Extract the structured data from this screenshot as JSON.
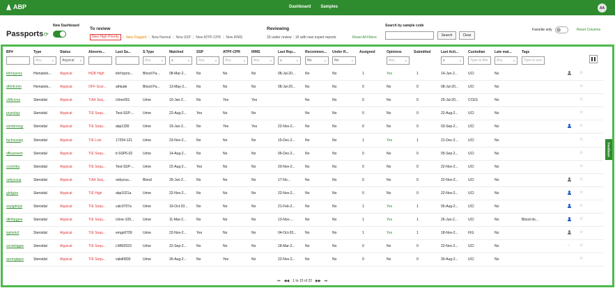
{
  "app": {
    "name": "ABP",
    "nav": [
      "Dashboard",
      "Samples"
    ],
    "user_initials": "AA"
  },
  "page": {
    "title": "Passports",
    "new_dashboard_label": "New Dashboard"
  },
  "to_review": {
    "title": "To review",
    "filters": [
      "New High Priority",
      "New Flagged",
      "New Normal",
      "New SSP",
      "New ATPF-CPR",
      "New IRMS"
    ]
  },
  "reviewing": {
    "title": "Reviewing",
    "under_review": "33 under review",
    "expert_reports": "16 with new expert reports",
    "reset_all": "Reset All Filters"
  },
  "search": {
    "label": "Search by sample code",
    "search_button": "Search",
    "clear_button": "Clear"
  },
  "favorite": {
    "label": "Favorite only",
    "reset_columns": "Reset Columns"
  },
  "feedback": "Feedback",
  "columns": [
    "BP#",
    "Type",
    "Status",
    "Abnorm...",
    "Last Sa...",
    "S.Type",
    "Matched",
    "SSP",
    "ATPF-CPR",
    "IRMS",
    "Last Rep...",
    "Recommen...",
    "Under R...",
    "Assigned",
    "Opinions",
    "Submitted",
    "Last Acti...",
    "Custodian",
    "Late mat...",
    "Tags"
  ],
  "column_filters": {
    "type": "Any",
    "status": "Atypical",
    "stype": "Any",
    "matched": "≥",
    "ssp": "Any",
    "atpf": "Any",
    "irms": "Any",
    "lastrep": "≥",
    "recommen": "No",
    "under": "No",
    "opinions": "Any",
    "lastact": "≥",
    "custodian": "Type to filte",
    "late": "Any",
    "tags": "Type to sea"
  },
  "rows": [
    {
      "bp": "khrhcpnov",
      "type": "Hematolo...",
      "status": "Atypical",
      "abnorm": "HGB High",
      "last_sample": "khrhcpno...",
      "stype": "Blood Pa...",
      "matched": "08-Mar-2...",
      "ssp": "No",
      "atpf": "No",
      "irms": "No",
      "last_rep": "08-Jul-20...",
      "recommen": "No",
      "under": "No",
      "assigned": "1",
      "opinions": "Yes",
      "submitted": "1",
      "last_act": "14-Jun-2...",
      "custodian": "UCI",
      "late": "No",
      "tags": "",
      "person": "grey"
    },
    {
      "bp": "dhfnfcmm",
      "type": "Hematolo...",
      "status": "Atypical",
      "abnorm": "OFF-Scor...",
      "last_sample": "aihtude",
      "stype": "Blood Pa...",
      "matched": "13-May-2...",
      "ssp": "No",
      "atpf": "No",
      "irms": "No",
      "last_rep": "08-Jul-20...",
      "recommen": "No",
      "under": "No",
      "assigned": "0",
      "opinions": "No",
      "submitted": "0",
      "last_act": "08-Jul-20...",
      "custodian": "UCI",
      "late": "No",
      "tags": "",
      "person": "none"
    },
    {
      "bp": "cfdfcnmo",
      "type": "Steroidal",
      "status": "Atypical",
      "abnorm": "T/A4 Seq...",
      "last_sample": "Urine001",
      "stype": "Urine",
      "matched": "10-Jan-2...",
      "ssp": "No",
      "atpf": "Yes",
      "irms": "Yes",
      "last_rep": "",
      "recommen": "No",
      "under": "No",
      "assigned": "0",
      "opinions": "No",
      "submitted": "0",
      "last_act": "25-Jul-20...",
      "custodian": "CCES",
      "late": "No",
      "tags": "",
      "person": "none"
    },
    {
      "bp": "pryeclejz",
      "type": "Steroidal",
      "status": "Atypical",
      "abnorm": "T/E Sequ...",
      "last_sample": "Test-SSP-...",
      "stype": "Urine",
      "matched": "22-Aug-2...",
      "ssp": "Yes",
      "atpf": "No",
      "irms": "No",
      "last_rep": "",
      "recommen": "No",
      "under": "No",
      "assigned": "0",
      "opinions": "No",
      "submitted": "0",
      "last_act": "22-Aug-2...",
      "custodian": "UCI",
      "late": "No",
      "tags": "",
      "person": "none"
    },
    {
      "bp": "exmbrvoqy",
      "type": "Steroidal",
      "status": "Atypical",
      "abnorm": "T/E Sequ...",
      "last_sample": "abp1330",
      "stype": "Urine",
      "matched": "19-Jun-2...",
      "ssp": "No",
      "atpf": "Yes",
      "irms": "Yes",
      "last_rep": "22-Nov-2...",
      "recommen": "No",
      "under": "No",
      "assigned": "0",
      "opinions": "No",
      "submitted": "0",
      "last_act": "03-Sep-2...",
      "custodian": "UCI",
      "late": "No",
      "tags": "",
      "person": "blue"
    },
    {
      "bp": "fuchnoxwg",
      "type": "Steroidal",
      "status": "Atypical",
      "abnorm": "T/E Low",
      "last_sample": "17254-121",
      "stype": "Urine",
      "matched": "23-Nov-2...",
      "ssp": "No",
      "atpf": "No",
      "irms": "No",
      "last_rep": "15-Dec-2...",
      "recommen": "No",
      "under": "No",
      "assigned": "1",
      "opinions": "Yes",
      "submitted": "1",
      "last_act": "21-Dec-2...",
      "custodian": "UCI",
      "late": "No",
      "tags": "",
      "person": "none"
    },
    {
      "bp": "dfbazwwm",
      "type": "Steroidal",
      "status": "Atypical",
      "abnorm": "T/E Sequ...",
      "last_sample": "ti-SSP6-02",
      "stype": "Urine",
      "matched": "14-Aug-2...",
      "ssp": "No",
      "atpf": "No",
      "irms": "No",
      "last_rep": "06-Dec-2...",
      "recommen": "No",
      "under": "No",
      "assigned": "0",
      "opinions": "No",
      "submitted": "0",
      "last_act": "05-Sep-2...",
      "custodian": "UCI",
      "late": "No",
      "tags": "",
      "person": "none"
    },
    {
      "bp": "ccslchka",
      "type": "Steroidal",
      "status": "Atypical",
      "abnorm": "T/E Sequ...",
      "last_sample": "Test-SSP-...",
      "stype": "Urine",
      "matched": "22-Aug-2...",
      "ssp": "Yes",
      "atpf": "No",
      "irms": "No",
      "last_rep": "20-Nov-2...",
      "recommen": "No",
      "under": "No",
      "assigned": "0",
      "opinions": "No",
      "submitted": "0",
      "last_act": "22-Nov-2...",
      "custodian": "UCI",
      "late": "No",
      "tags": "",
      "person": "none"
    },
    {
      "bp": "oebycsua",
      "type": "Steroidal",
      "status": "Atypical",
      "abnorm": "T/A4 Seq...",
      "last_sample": "oebycsu...",
      "stype": "Blood",
      "matched": "29-Jun-2...",
      "ssp": "No",
      "atpf": "No",
      "irms": "No",
      "last_rep": "17-No...",
      "recommen": "No",
      "under": "No",
      "assigned": "0",
      "opinions": "No",
      "submitted": "0",
      "last_act": "22-Nov-2...",
      "custodian": "UCI",
      "late": "No",
      "tags": "",
      "person": "grey"
    },
    {
      "bp": "glofgize",
      "type": "Steroidal",
      "status": "Atypical",
      "abnorm": "T/E High",
      "last_sample": "abp1021a",
      "stype": "Urine",
      "matched": "22-Nov-2...",
      "ssp": "No",
      "atpf": "No",
      "irms": "No",
      "last_rep": "22-Nov-2...",
      "recommen": "No",
      "under": "No",
      "assigned": "0",
      "opinions": "No",
      "submitted": "0",
      "last_act": "22-Nov-2...",
      "custodian": "UCI",
      "late": "No",
      "tags": "",
      "person": "blue"
    },
    {
      "bp": "sxylgdmjsi",
      "type": "Steroidal",
      "status": "Atypical",
      "abnorm": "T/E Sequ...",
      "last_sample": "calc0707a",
      "stype": "Urine",
      "matched": "19-Oct-20...",
      "ssp": "No",
      "atpf": "No",
      "irms": "No",
      "last_rep": "21-Feb-2...",
      "recommen": "No",
      "under": "No",
      "assigned": "1",
      "opinions": "Yes",
      "submitted": "1",
      "last_act": "05-Aug-2...",
      "custodian": "UCI",
      "late": "No",
      "tags": "",
      "person": "blue"
    },
    {
      "bp": "dkhfqqgne",
      "type": "Steroidal",
      "status": "Atypical",
      "abnorm": "T/E Sequ...",
      "last_sample": "Urine-109...",
      "stype": "Urine",
      "matched": "11-Mar-2...",
      "ssp": "No",
      "atpf": "No",
      "irms": "No",
      "last_rep": "13-Nov-...",
      "recommen": "No",
      "under": "No",
      "assigned": "1",
      "opinions": "Yes",
      "submitted": "1",
      "last_act": "26-Jun-2...",
      "custodian": "UCI",
      "late": "No",
      "tags": "Blood do...",
      "person": "blue"
    },
    {
      "bp": "kjehshcf",
      "type": "Steroidal",
      "status": "Atypical",
      "abnorm": "T/E Sequ...",
      "last_sample": "emgo0709",
      "stype": "Urine",
      "matched": "22-Nov-2...",
      "ssp": "Yes",
      "atpf": "No",
      "irms": "No",
      "last_rep": "04-Oct-20...",
      "recommen": "No",
      "under": "No",
      "assigned": "1",
      "opinions": "Yes",
      "submitted": "1",
      "last_act": "18-Nov-2...",
      "custodian": "FIG",
      "late": "No",
      "tags": "",
      "person": "grey"
    },
    {
      "bp": "exctebigpw",
      "type": "Steroidal",
      "status": "Atypical",
      "abnorm": "T/E Sequ...",
      "last_sample": "LMW2023",
      "stype": "Urine",
      "matched": "22-Sep-2...",
      "ssp": "No",
      "atpf": "No",
      "irms": "No",
      "last_rep": "18-Mar-2...",
      "recommen": "No",
      "under": "No",
      "assigned": "0",
      "opinions": "No",
      "submitted": "0",
      "last_act": "22-Nov-2...",
      "custodian": "UCI",
      "late": "No",
      "tags": "",
      "person": "circle"
    },
    {
      "bp": "acxmgkgvs",
      "type": "Steroidal",
      "status": "Atypical",
      "abnorm": "T/E Sequ...",
      "last_sample": "valid0830",
      "stype": "Urine",
      "matched": "30-Aug-2...",
      "ssp": "No",
      "atpf": "Yes",
      "irms": "No",
      "last_rep": "22-Nov-2...",
      "recommen": "No",
      "under": "No",
      "assigned": "0",
      "opinions": "No",
      "submitted": "0",
      "last_act": "30-Aug-2...",
      "custodian": "UCI",
      "late": "No",
      "tags": "",
      "person": "none"
    }
  ],
  "pagination": {
    "label": "1 to 15 of 22"
  },
  "colors": {
    "brand": "#2e8b2e",
    "frame": "#4cba4c",
    "alert": "#d33333",
    "flag": "#e08a00",
    "assigned_user": "#1e5bbf"
  }
}
